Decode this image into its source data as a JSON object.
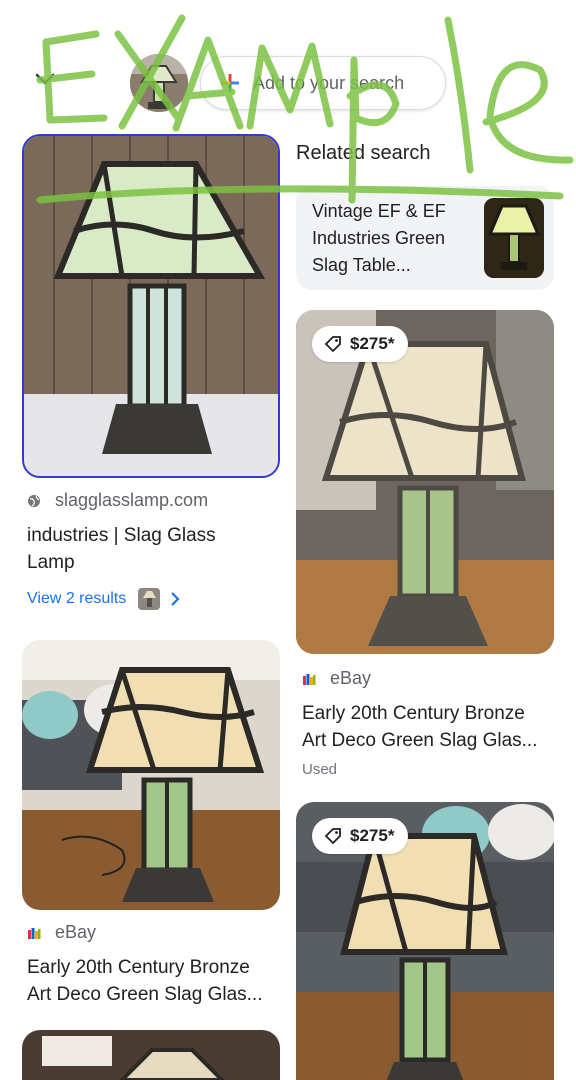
{
  "header": {
    "add_search_label": "Add to your search"
  },
  "overlay": {
    "scribble_text": "EXAMPLE"
  },
  "related": {
    "heading": "Related search",
    "card_text": "Vintage EF & EF Industries Green Slag Table..."
  },
  "results": [
    {
      "source": "slagglasslamp.com",
      "title_line1": "industries | Slag Glass",
      "title_line2": "Lamp",
      "view_label": "View 2 results"
    },
    {
      "price": "$275*",
      "source": "eBay",
      "title_line1": "Early 20th Century Bronze",
      "title_line2": "Art Deco Green Slag Glas...",
      "condition": "Used"
    },
    {
      "source": "eBay",
      "title_line1": "Early 20th Century Bronze",
      "title_line2": "Art Deco Green Slag Glas..."
    },
    {
      "price": "$275*"
    }
  ],
  "colors": {
    "link_blue": "#1a73e8",
    "selected_border": "#2f3bd1",
    "scribble_green": "#7cc242"
  }
}
